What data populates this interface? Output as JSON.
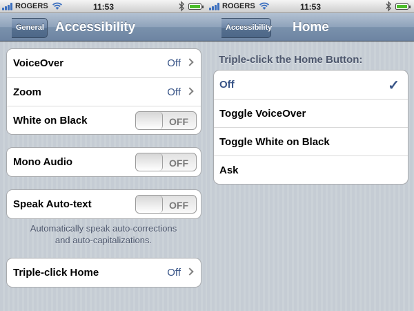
{
  "left": {
    "status": {
      "carrier": "ROGERS",
      "time": "11:53"
    },
    "nav": {
      "back_label": "General",
      "title": "Accessibility"
    },
    "groups": [
      {
        "rows": [
          {
            "label": "VoiceOver",
            "value": "Off"
          },
          {
            "label": "Zoom",
            "value": "Off"
          },
          {
            "label": "White on Black",
            "toggle": "OFF"
          }
        ]
      },
      {
        "rows": [
          {
            "label": "Mono Audio",
            "toggle": "OFF"
          }
        ]
      },
      {
        "rows": [
          {
            "label": "Speak Auto-text",
            "toggle": "OFF"
          }
        ]
      },
      {
        "rows": [
          {
            "label": "Triple-click Home",
            "value": "Off"
          }
        ]
      }
    ],
    "footnote_line1": "Automatically speak auto-corrections",
    "footnote_line2": "and auto-capitalizations."
  },
  "right": {
    "status": {
      "carrier": "ROGERS",
      "time": "11:53"
    },
    "nav": {
      "back_label": "Accessibility",
      "title": "Home"
    },
    "section_header": "Triple-click the Home Button:",
    "options": [
      "Off",
      "Toggle VoiceOver",
      "Toggle White on Black",
      "Ask"
    ],
    "selected_option": "Off"
  },
  "icons": {
    "signal": "signal-bars-icon",
    "wifi": "wifi-icon",
    "bluetooth": "bluetooth-icon",
    "battery": "battery-icon",
    "chevron": "chevron-right-icon",
    "check": "checkmark-icon"
  },
  "colors": {
    "nav_blue": "#6d84a2",
    "value_blue": "#385487",
    "background": "#c5ccd4"
  }
}
